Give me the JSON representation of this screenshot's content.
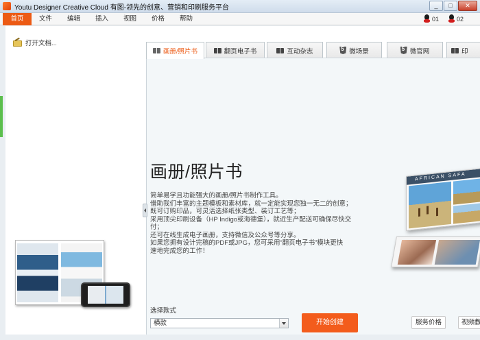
{
  "window": {
    "title": "Youtu Designer Creative Cloud 有图-领先的创意、营销和印刷服务平台",
    "minimize": "_",
    "maximize": "□",
    "close": "✕"
  },
  "menu": {
    "items": [
      "首页",
      "文件",
      "编辑",
      "插入",
      "视图",
      "价格",
      "帮助"
    ],
    "qq1": "01",
    "qq2": "02"
  },
  "sidebar": {
    "open_doc": "打开文档..."
  },
  "tabs": [
    {
      "label": "画册/照片书",
      "icon": "book-icon"
    },
    {
      "label": "翻页电子书",
      "icon": "book-icon"
    },
    {
      "label": "互动杂志",
      "icon": "book-icon"
    },
    {
      "label": "微场景",
      "icon": "html5-icon"
    },
    {
      "label": "微官网",
      "icon": "html5-icon"
    },
    {
      "label": "印",
      "icon": "book-icon"
    }
  ],
  "content": {
    "title": "画册/照片书",
    "lines": [
      "简单易学且功能强大的画册/照片书制作工具。",
      "借助我们丰富的主题模板和素材库，就一定能实现您独一无二的创意；",
      "既可订购印品，可灵活选择纸张类型、装订工艺等；",
      "采用顶尖印刷设备（HP Indigo或海德堡），就近生产配送可确保尽快交",
      "付；",
      "还可在线生成电子画册，支持微信及公众号等分享。",
      "如果您拥有设计完稿的PDF或JPG，您可采用“翻页电子书”模块更快",
      "速地完成您的工作！"
    ],
    "hero_text": "AFRICAN SAFA",
    "style_label": "选择款式",
    "style_value": "横款",
    "create_button": "开始创建",
    "price_button": "服务价格",
    "video_button": "视频教程"
  }
}
